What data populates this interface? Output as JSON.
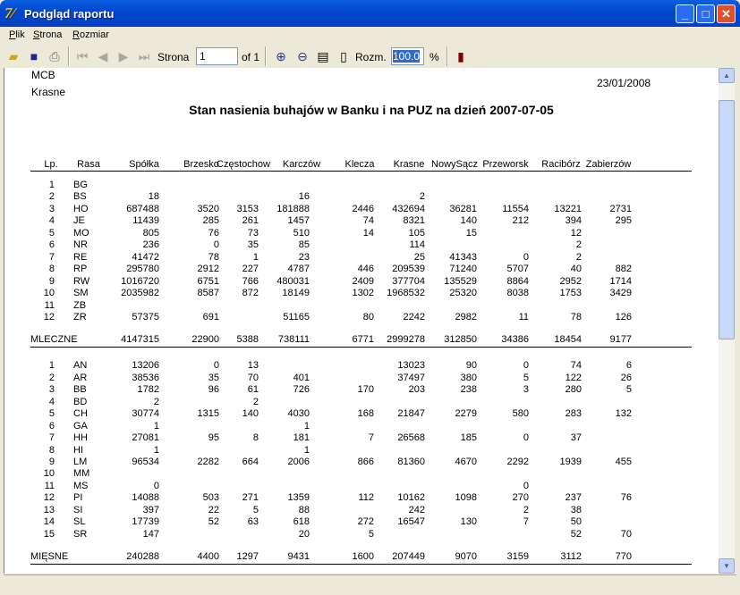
{
  "window": {
    "title": "Podgląd raportu",
    "icon": "app-logo-icon",
    "buttons": [
      "minimize",
      "maximize",
      "close"
    ]
  },
  "menu": [
    "Plik",
    "Strona",
    "Rozmiar"
  ],
  "toolbar": {
    "page_label": "Strona",
    "page_value": "1",
    "page_of": "of 1",
    "zoom_label": "Rozm.",
    "zoom_value": "100.0",
    "zoom_unit": "%"
  },
  "report": {
    "org": "MCB",
    "place": "Krasne",
    "date": "23/01/2008",
    "title": "Stan nasienia buhajów w Banku i na PUZ na dzień 2007-07-05",
    "headers": [
      "Lp.",
      "Rasa",
      "Spółka",
      "Brzesko",
      "Częstochow",
      "Karczów",
      "Klecza",
      "Krasne",
      "NowySącz",
      "Przeworsk",
      "Racibórz",
      "Zabierzów"
    ],
    "sections": [
      {
        "rows": [
          [
            "1",
            "BG",
            "",
            "",
            "",
            "",
            "",
            "",
            "",
            "",
            "",
            ""
          ],
          [
            "2",
            "BS",
            "18",
            "",
            "",
            "16",
            "",
            "2",
            "",
            "",
            "",
            ""
          ],
          [
            "3",
            "HO",
            "687488",
            "3520",
            "3153",
            "181888",
            "2446",
            "432694",
            "36281",
            "11554",
            "13221",
            "2731"
          ],
          [
            "4",
            "JE",
            "11439",
            "285",
            "261",
            "1457",
            "74",
            "8321",
            "140",
            "212",
            "394",
            "295"
          ],
          [
            "5",
            "MO",
            "805",
            "76",
            "73",
            "510",
            "14",
            "105",
            "15",
            "",
            "12",
            ""
          ],
          [
            "6",
            "NR",
            "236",
            "0",
            "35",
            "85",
            "",
            "114",
            "",
            "",
            "2",
            ""
          ],
          [
            "7",
            "RE",
            "41472",
            "78",
            "1",
            "23",
            "",
            "25",
            "41343",
            "0",
            "2",
            ""
          ],
          [
            "8",
            "RP",
            "295780",
            "2912",
            "227",
            "4787",
            "446",
            "209539",
            "71240",
            "5707",
            "40",
            "882"
          ],
          [
            "9",
            "RW",
            "1016720",
            "6751",
            "766",
            "480031",
            "2409",
            "377704",
            "135529",
            "8864",
            "2952",
            "1714"
          ],
          [
            "10",
            "SM",
            "2035982",
            "8587",
            "872",
            "18149",
            "1302",
            "1968532",
            "25320",
            "8038",
            "1753",
            "3429"
          ],
          [
            "11",
            "ZB",
            "",
            "",
            "",
            "",
            "",
            "",
            "",
            "",
            "",
            ""
          ],
          [
            "12",
            "ZR",
            "57375",
            "691",
            "",
            "51165",
            "80",
            "2242",
            "2982",
            "11",
            "78",
            "126"
          ]
        ],
        "total": [
          "MLECZNE",
          "4147315",
          "22900",
          "5388",
          "738111",
          "6771",
          "2999278",
          "312850",
          "34386",
          "18454",
          "9177"
        ]
      },
      {
        "rows": [
          [
            "1",
            "AN",
            "13206",
            "0",
            "13",
            "",
            "",
            "13023",
            "90",
            "0",
            "74",
            "6"
          ],
          [
            "2",
            "AR",
            "38536",
            "35",
            "70",
            "401",
            "",
            "37497",
            "380",
            "5",
            "122",
            "26"
          ],
          [
            "3",
            "BB",
            "1782",
            "96",
            "61",
            "726",
            "170",
            "203",
            "238",
            "3",
            "280",
            "5"
          ],
          [
            "4",
            "BD",
            "2",
            "",
            "2",
            "",
            "",
            "",
            "",
            "",
            "",
            ""
          ],
          [
            "5",
            "CH",
            "30774",
            "1315",
            "140",
            "4030",
            "168",
            "21847",
            "2279",
            "580",
            "283",
            "132"
          ],
          [
            "6",
            "GA",
            "1",
            "",
            "",
            "1",
            "",
            "",
            "",
            "",
            "",
            ""
          ],
          [
            "7",
            "HH",
            "27081",
            "95",
            "8",
            "181",
            "7",
            "26568",
            "185",
            "0",
            "37",
            ""
          ],
          [
            "8",
            "HI",
            "1",
            "",
            "",
            "1",
            "",
            "",
            "",
            "",
            "",
            ""
          ],
          [
            "9",
            "LM",
            "96534",
            "2282",
            "664",
            "2006",
            "866",
            "81360",
            "4670",
            "2292",
            "1939",
            "455"
          ],
          [
            "10",
            "MM",
            "",
            "",
            "",
            "",
            "",
            "",
            "",
            "",
            "",
            ""
          ],
          [
            "11",
            "MS",
            "0",
            "",
            "",
            "",
            "",
            "",
            "",
            "0",
            "",
            ""
          ],
          [
            "12",
            "PI",
            "14088",
            "503",
            "271",
            "1359",
            "112",
            "10162",
            "1098",
            "270",
            "237",
            "76"
          ],
          [
            "13",
            "SI",
            "397",
            "22",
            "5",
            "88",
            "",
            "242",
            "",
            "2",
            "38",
            ""
          ],
          [
            "14",
            "SL",
            "17739",
            "52",
            "63",
            "618",
            "272",
            "16547",
            "130",
            "7",
            "50",
            ""
          ],
          [
            "15",
            "SR",
            "147",
            "",
            "",
            "20",
            "5",
            "",
            "",
            "",
            "52",
            "70"
          ]
        ],
        "total": [
          "MIĘSNE",
          "240288",
          "4400",
          "1297",
          "9431",
          "1600",
          "207449",
          "9070",
          "3159",
          "3112",
          "770"
        ]
      }
    ]
  }
}
